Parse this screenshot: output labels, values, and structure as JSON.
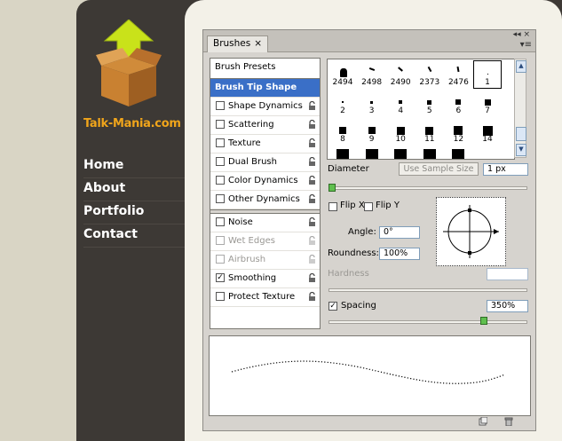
{
  "site": {
    "brand": "Talk-Mania.com",
    "nav": [
      "Home",
      "About",
      "Portfolio",
      "Contact"
    ]
  },
  "panel": {
    "tab_label": "Brushes",
    "tab_close": "×",
    "collapse_glyph": "◂◂ ×",
    "menu_glyph": "▾≡",
    "brush_presets_label": "Brush Presets",
    "sections": [
      {
        "label": "Brush Tip Shape",
        "selected": true
      },
      {
        "label": "Shape Dynamics",
        "checked": false,
        "lock": true
      },
      {
        "label": "Scattering",
        "checked": false,
        "lock": true
      },
      {
        "label": "Texture",
        "checked": false,
        "lock": true
      },
      {
        "label": "Dual Brush",
        "checked": false,
        "lock": true
      },
      {
        "label": "Color Dynamics",
        "checked": false,
        "lock": true
      },
      {
        "label": "Other Dynamics",
        "checked": false,
        "lock": true
      },
      {
        "label": "Noise",
        "checked": false,
        "lock": true
      },
      {
        "label": "Wet Edges",
        "checked": false,
        "lock": true,
        "disabled": true
      },
      {
        "label": "Airbrush",
        "checked": false,
        "lock": true,
        "disabled": true
      },
      {
        "label": "Smoothing",
        "checked": true,
        "lock": true
      },
      {
        "label": "Protect Texture",
        "checked": false,
        "lock": true
      }
    ],
    "preset_rows": [
      [
        "2494",
        "2498",
        "2490",
        "2373",
        "2476",
        "1"
      ],
      [
        "2",
        "3",
        "4",
        "5",
        "6",
        "7"
      ],
      [
        "8",
        "9",
        "10",
        "11",
        "12",
        "14"
      ]
    ],
    "selected_preset": "1",
    "diameter_label": "Diameter",
    "use_sample_size_label": "Use Sample Size",
    "diameter_value": "1 px",
    "flip_x_label": "Flip X",
    "flip_y_label": "Flip Y",
    "angle_label": "Angle:",
    "angle_value": "0°",
    "roundness_label": "Roundness:",
    "roundness_value": "100%",
    "hardness_label": "Hardness",
    "hardness_value": "",
    "spacing_label": "Spacing",
    "spacing_checked": true,
    "spacing_value": "350%",
    "spacing_slider_fraction": 0.8,
    "diameter_slider_fraction": 0.0
  }
}
